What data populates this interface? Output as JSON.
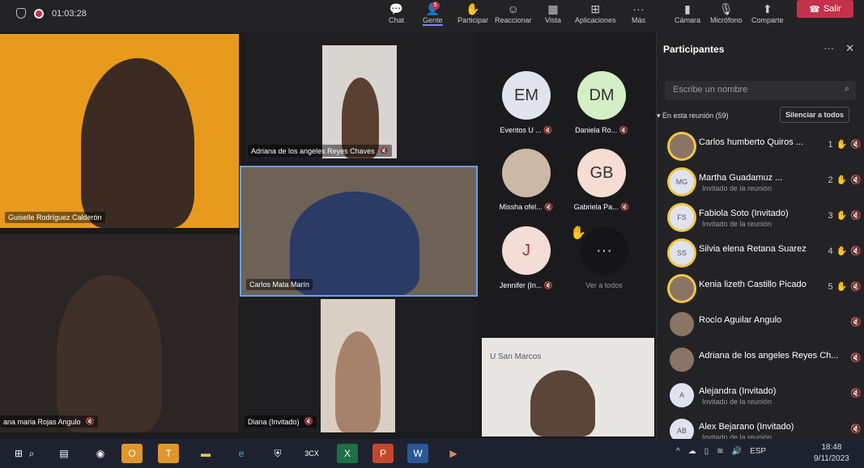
{
  "topbar": {
    "timer": "01:03:28",
    "buttons": [
      {
        "label": "Chat",
        "icon": "chat-icon"
      },
      {
        "label": "Gente",
        "icon": "people-icon",
        "badge": "5"
      },
      {
        "label": "Participar",
        "icon": "raise-hand-icon"
      },
      {
        "label": "Reaccionar",
        "icon": "smile-icon"
      },
      {
        "label": "Vista",
        "icon": "view-icon"
      },
      {
        "label": "Aplicaciones",
        "icon": "apps-icon"
      },
      {
        "label": "Más",
        "icon": "more-icon"
      },
      {
        "label": "Cámara",
        "icon": "camera-icon"
      },
      {
        "label": "Micrófono",
        "icon": "mic-icon"
      },
      {
        "label": "Comparte",
        "icon": "share-icon"
      }
    ],
    "leave": "Salir"
  },
  "tiles": [
    {
      "name": "Guiselle Rodríguez Calderón"
    },
    {
      "name": "Adriana de los angeles Reyes Chaves"
    },
    {
      "name": "Carlos Mata Marín"
    },
    {
      "name": "ana maria Rojas Angulo"
    },
    {
      "name": "Diana (Invitado)"
    }
  ],
  "shared_tile": {
    "logo_text": "U San Marcos"
  },
  "avatars": [
    {
      "initials": "EM",
      "name": "Eventos U ..."
    },
    {
      "initials": "DM",
      "name": "Daniela Ro..."
    },
    {
      "initials": "",
      "name": "Missha ofel..."
    },
    {
      "initials": "GB",
      "name": "Gabriela Pa..."
    },
    {
      "initials": "J",
      "name": "Jennifer (In..."
    },
    {
      "initials": "···",
      "name": "Ver a todos"
    }
  ],
  "panel": {
    "title": "Participantes",
    "search_placeholder": "Escribe un nombre",
    "section": "En esta reunión (59)",
    "mute_all": "Silenciar a todos",
    "participants": [
      {
        "initials": "",
        "name": "Carlos humberto Quiros ...",
        "sub": "",
        "hand": "1"
      },
      {
        "initials": "MG",
        "name": "Martha Guadamuz ...",
        "sub": "Invitado de la reunión",
        "hand": "2"
      },
      {
        "initials": "FS",
        "name": "Fabiola Soto (Invitado)",
        "sub": "Invitado de la reunión",
        "hand": "3"
      },
      {
        "initials": "SS",
        "name": "Silvia elena Retana Suarez",
        "sub": "",
        "hand": "4"
      },
      {
        "initials": "",
        "name": "Kenia lizeth Castillo Picado",
        "sub": "",
        "hand": "5"
      },
      {
        "initials": "",
        "name": "Rocío Aguilar Angulo",
        "sub": "",
        "hand": ""
      },
      {
        "initials": "",
        "name": "Adriana de los angeles Reyes Ch...",
        "sub": "",
        "hand": ""
      },
      {
        "initials": "A",
        "name": "Alejandra (Invitado)",
        "sub": "Invitado de la reunión",
        "hand": ""
      },
      {
        "initials": "AB",
        "name": "Alex Bejarano (Invitado)",
        "sub": "Invitado de la reunión",
        "hand": ""
      }
    ]
  },
  "taskbar": {
    "apps": [
      "search",
      "task-view",
      "chrome",
      "outlook",
      "teams",
      "explorer",
      "edge",
      "security",
      "3cx",
      "excel",
      "powerpoint",
      "word",
      "media-player"
    ],
    "lang": "ESP",
    "time": "18:48",
    "date": "9/11/2023"
  },
  "colors": {
    "accent": "#7f85f5",
    "leave": "#c4314b",
    "hand": "#f2c744"
  }
}
